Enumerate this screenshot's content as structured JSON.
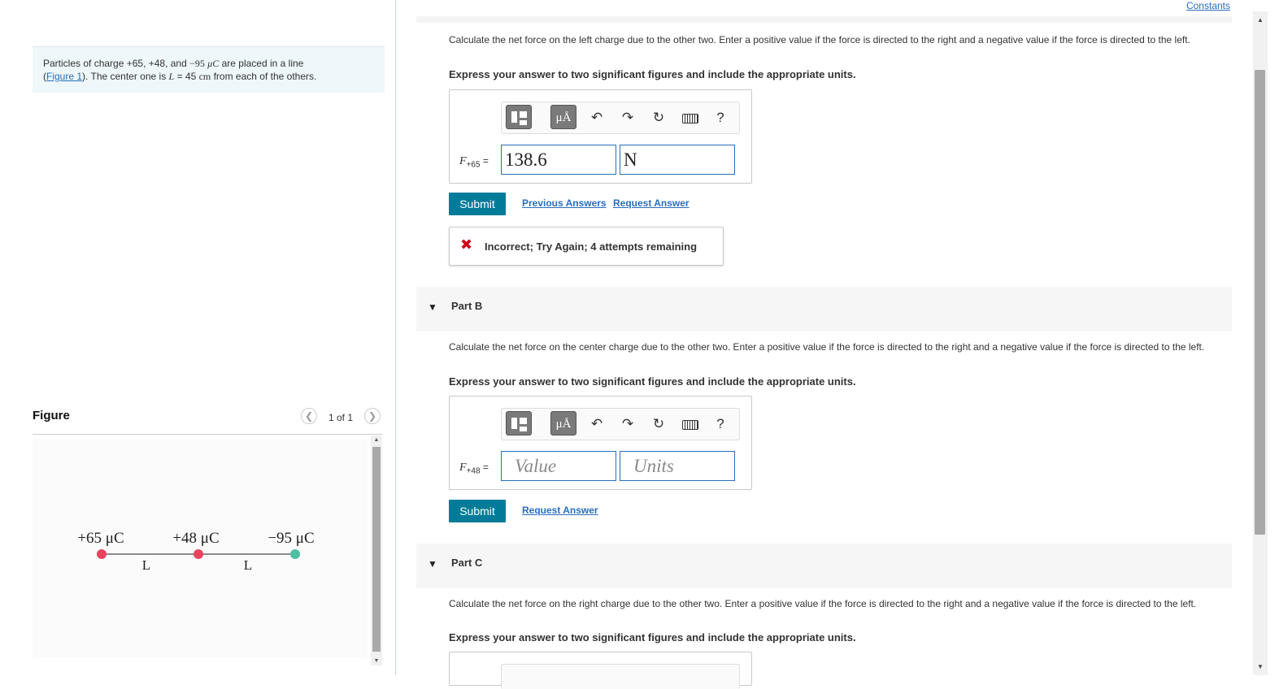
{
  "constants_link": "Constants",
  "problem": {
    "text1": "Particles of charge +65, +48, and ",
    "charge_neg": "−95",
    "unit_mu": "μC",
    "text2": " are placed in a line",
    "figure_link": "Figure 1",
    "text3": ". The center one is ",
    "L_var": "L",
    "eq": " = 45 ",
    "cm": "cm",
    "text4": " from each of the others."
  },
  "figure": {
    "title": "Figure",
    "count": "1 of 1",
    "labels": [
      "+65 μC",
      "+48 μC",
      "−95 μC"
    ],
    "spacing_labels": [
      "L",
      "L"
    ],
    "colors": {
      "positive": "#e8445f",
      "negative": "#4dbfa3"
    }
  },
  "partA": {
    "question": "Calculate the net force on the left charge due to the other two. Enter a positive value if the force is directed to the right and a negative value if the force is directed to the left.",
    "express": "Express your answer to two significant figures and include the appropriate units.",
    "var_name": "F",
    "var_sub": "+65",
    "equals": "=",
    "value": "138.6",
    "units": "N",
    "submit": "Submit",
    "previous_answers": "Previous Answers",
    "request_answer": "Request Answer",
    "feedback": "Incorrect; Try Again; 4 attempts remaining"
  },
  "partB": {
    "title": "Part B",
    "question": "Calculate the net force on the center charge due to the other two. Enter a positive value if the force is directed to the right and a negative value if the force is directed to the left.",
    "express": "Express your answer to two significant figures and include the appropriate units.",
    "var_name": "F",
    "var_sub": "+48",
    "equals": "=",
    "value_placeholder": "Value",
    "units_placeholder": "Units",
    "submit": "Submit",
    "request_answer": "Request Answer"
  },
  "partC": {
    "title": "Part C",
    "question": "Calculate the net force on the right charge due to the other two. Enter a positive value if the force is directed to the right and a negative value if the force is directed to the left.",
    "express": "Express your answer to two significant figures and include the appropriate units."
  },
  "toolbar": {
    "units_glyph": "μÅ",
    "help": "?"
  }
}
